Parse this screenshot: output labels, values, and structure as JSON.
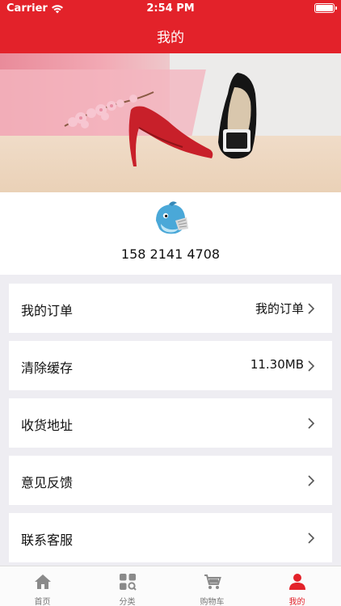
{
  "status_bar": {
    "carrier": "Carrier",
    "time": "2:54 PM"
  },
  "nav": {
    "title": "我的"
  },
  "profile": {
    "phone": "158 2141 4708"
  },
  "menu": [
    {
      "label": "我的订单",
      "value": "我的订单"
    },
    {
      "label": "清除缓存",
      "value": "11.30MB"
    },
    {
      "label": "收货地址",
      "value": ""
    },
    {
      "label": "意见反馈",
      "value": ""
    },
    {
      "label": "联系客服",
      "value": ""
    }
  ],
  "tabs": [
    {
      "label": "首页",
      "icon": "home-icon"
    },
    {
      "label": "分类",
      "icon": "category-icon"
    },
    {
      "label": "购物车",
      "icon": "cart-icon"
    },
    {
      "label": "我的",
      "icon": "person-icon",
      "active": true
    }
  ],
  "colors": {
    "accent": "#e3222a",
    "background": "#eeedf2",
    "tab_inactive": "#777777"
  }
}
